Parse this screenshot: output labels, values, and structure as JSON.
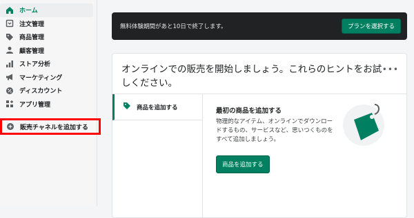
{
  "sidebar": {
    "items": [
      {
        "label": "ホーム",
        "icon": "home-icon",
        "active": true
      },
      {
        "label": "注文管理",
        "icon": "orders-icon"
      },
      {
        "label": "商品管理",
        "icon": "tag-icon"
      },
      {
        "label": "顧客管理",
        "icon": "person-icon"
      },
      {
        "label": "ストア分析",
        "icon": "bar-chart-icon"
      },
      {
        "label": "マーケティング",
        "icon": "megaphone-icon"
      },
      {
        "label": "ディスカウント",
        "icon": "discount-icon"
      },
      {
        "label": "アプリ管理",
        "icon": "apps-icon"
      }
    ],
    "sales_channel_label": "販売チャネルを追加する"
  },
  "banner": {
    "text": "無料体験期間があと10日で終了します。",
    "button_label": "プランを選択する"
  },
  "card": {
    "title": "オンラインでの販売を開始しましょう。これらのヒントをお試しください。",
    "more_label": "•••",
    "tab_label": "商品を追加する",
    "tip_title": "最初の商品を追加する",
    "tip_body": "物理的なアイテム、オンラインでダウンロードするもの、サービスなど、思いつくものをすべて追加しましょう。",
    "button_label": "商品を追加する"
  },
  "colors": {
    "accent": "#008060",
    "banner_bg": "#202223",
    "highlight": "#ff0000"
  }
}
